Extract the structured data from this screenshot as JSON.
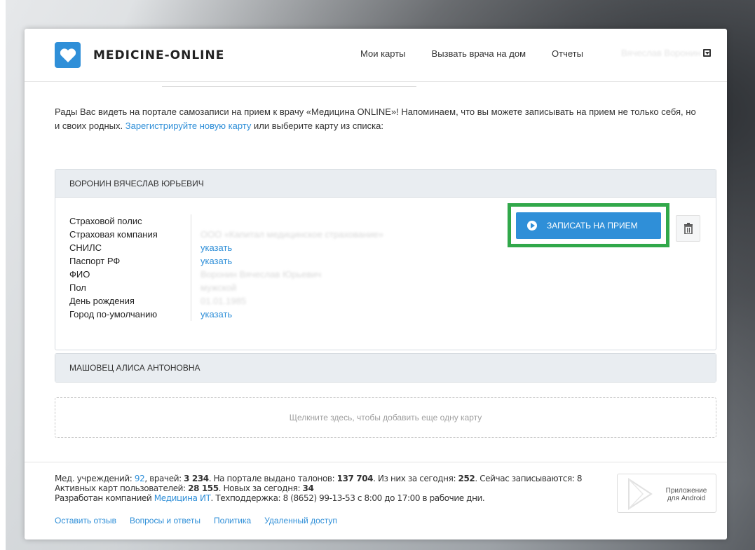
{
  "brand": {
    "name": "MEDICINE-ONLINE",
    "logo_color": "#2f8fd8"
  },
  "nav": {
    "items": [
      "Мои карты",
      "Вызвать врача на дом",
      "Отчеты"
    ],
    "user": "Вячеслав Воронин"
  },
  "intro": {
    "text_before": "Рады Вас видеть на портале самозаписи на прием к врачу «Медицина ONLINE»! Напоминаем, что вы можете записывать на прием не только себя, но и своих родных. ",
    "link": "Зарегистрируйте новую карту",
    "text_after": " или выберите карту из списка:"
  },
  "patients": [
    {
      "name": "ВОРОНИН ВЯЧЕСЛАВ ЮРЬЕВИЧ",
      "fields": [
        {
          "label": "Страховой полис",
          "value": ""
        },
        {
          "label": "Страховая компания",
          "value": "ООО «Капитал медицинское страхование»"
        },
        {
          "label": "СНИЛС",
          "value": "указать"
        },
        {
          "label": "Паспорт РФ",
          "value": "указать"
        },
        {
          "label": "ФИО",
          "value": "Воронин Вячеслав Юрьевич"
        },
        {
          "label": "Пол",
          "value": "мужской"
        },
        {
          "label": "День рождения",
          "value": "01.01.1985"
        },
        {
          "label": "Город по-умолчанию",
          "value": "указать"
        }
      ],
      "appointment_button": "ЗАПИСАТЬ НА ПРИЕМ"
    },
    {
      "name": "МАШОВЕЦ АЛИСА АНТОНОВНА"
    }
  ],
  "add_card": "Щелкните здесь, чтобы добавить еще одну карту",
  "stats": {
    "l1_a": "Мед. учреждений: ",
    "institutions": "92",
    "l1_b": ", врачей: ",
    "doctors": "3 234",
    "l1_c": ". На портале выдано талонов: ",
    "tickets": "137 704",
    "l1_d": ". Из них за сегодня: ",
    "today": "252",
    "l1_e": ". Сейчас записываются: 8",
    "l2_a": "Активных карт пользователей: ",
    "active_cards": "28 155",
    "l2_b": ". Новых за сегодня: ",
    "new_today": "34",
    "l3_a": "Разработан компанией ",
    "company": "Медицина ИТ",
    "l3_b": ". Техподдержка: 8 (8652) 99-13-53 с 8:00 до 17:00 в рабочие дни."
  },
  "footer_links": [
    "Оставить отзыв",
    "Вопросы и ответы",
    "Политика",
    "Удаленный доступ"
  ],
  "android": {
    "line1": "Приложение",
    "line2": "для Android"
  },
  "colors": {
    "accent": "#2f8fd8",
    "highlight": "#31a84a",
    "header_bg": "#e9edf1"
  }
}
